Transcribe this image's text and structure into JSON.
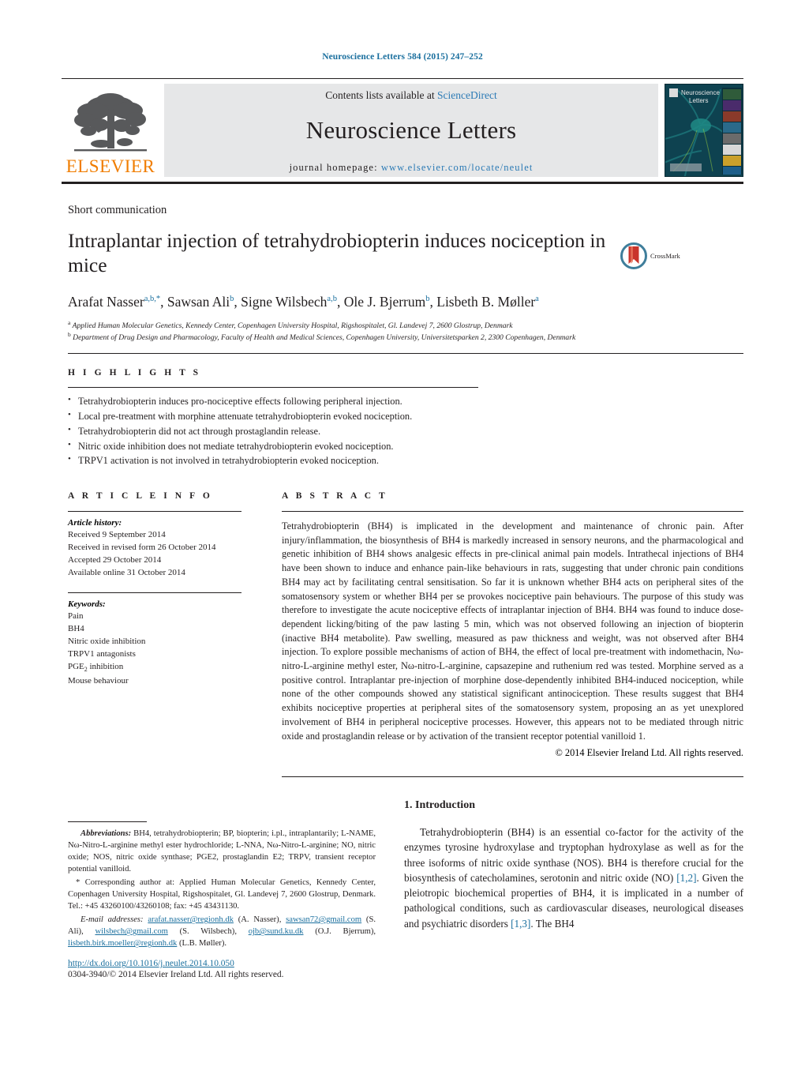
{
  "running_head": "Neuroscience Letters 584 (2015) 247–252",
  "masthead": {
    "contents_prefix": "Contents lists available at ",
    "sciencedirect": "ScienceDirect",
    "journal_name": "Neuroscience Letters",
    "homepage_prefix": "journal homepage: ",
    "homepage_url": "www.elsevier.com/locate/neulet",
    "publisher": "ELSEVIER",
    "cover_title_line1": "Neuroscience",
    "cover_title_line2": "Letters",
    "logo_icon": "elsevier-tree-icon",
    "cover_icon": "journal-cover-thumbnail"
  },
  "article": {
    "section_type": "Short communication",
    "title": "Intraplantar injection of tetrahydrobiopterin induces nociception in mice",
    "crossmark_label": "CrossMark",
    "crossmark_icon": "crossmark-icon",
    "authors": [
      {
        "name": "Arafat Nasser",
        "sup": "a,b,*"
      },
      {
        "name": "Sawsan Ali",
        "sup": "b"
      },
      {
        "name": "Signe Wilsbech",
        "sup": "a,b"
      },
      {
        "name": "Ole J. Bjerrum",
        "sup": "b"
      },
      {
        "name": "Lisbeth B. Møller",
        "sup": "a"
      }
    ],
    "affiliations": [
      {
        "marker": "a",
        "text": "Applied Human Molecular Genetics, Kennedy Center, Copenhagen University Hospital, Rigshospitalet, Gl. Landevej 7, 2600 Glostrup, Denmark"
      },
      {
        "marker": "b",
        "text": "Department of Drug Design and Pharmacology, Faculty of Health and Medical Sciences, Copenhagen University, Universitetsparken 2, 2300 Copenhagen, Denmark"
      }
    ]
  },
  "highlights": {
    "label": "H I G H L I G H T S",
    "items": [
      "Tetrahydrobiopterin induces pro-nociceptive effects following peripheral injection.",
      "Local pre-treatment with morphine attenuate tetrahydrobiopterin evoked nociception.",
      "Tetrahydrobiopterin did not act through prostaglandin release.",
      "Nitric oxide inhibition does not mediate tetrahydrobiopterin evoked nociception.",
      "TRPV1 activation is not involved in tetrahydrobiopterin evoked nociception."
    ]
  },
  "article_info": {
    "label": "A R T I C L E   I N F O",
    "history_label": "Article history:",
    "history": [
      "Received 9 September 2014",
      "Received in revised form 26 October 2014",
      "Accepted 29 October 2014",
      "Available online 31 October 2014"
    ],
    "keywords_label": "Keywords:",
    "keywords": [
      "Pain",
      "BH4",
      "Nitric oxide inhibition",
      "TRPV1 antagonists",
      "PGE2 inhibition",
      "Mouse behaviour"
    ]
  },
  "abstract": {
    "label": "A B S T R A C T",
    "text": "Tetrahydrobiopterin (BH4) is implicated in the development and maintenance of chronic pain. After injury/inflammation, the biosynthesis of BH4 is markedly increased in sensory neurons, and the pharmacological and genetic inhibition of BH4 shows analgesic effects in pre-clinical animal pain models. Intrathecal injections of BH4 have been shown to induce and enhance pain-like behaviours in rats, suggesting that under chronic pain conditions BH4 may act by facilitating central sensitisation. So far it is unknown whether BH4 acts on peripheral sites of the somatosensory system or whether BH4 per se provokes nociceptive pain behaviours. The purpose of this study was therefore to investigate the acute nociceptive effects of intraplantar injection of BH4. BH4 was found to induce dose-dependent licking/biting of the paw lasting 5 min, which was not observed following an injection of biopterin (inactive BH4 metabolite). Paw swelling, measured as paw thickness and weight, was not observed after BH4 injection. To explore possible mechanisms of action of BH4, the effect of local pre-treatment with indomethacin, Nω-nitro-L-arginine methyl ester, Nω-nitro-L-arginine, capsazepine and ruthenium red was tested. Morphine served as a positive control. Intraplantar pre-injection of morphine dose-dependently inhibited BH4-induced nociception, while none of the other compounds showed any statistical significant antinociception. These results suggest that BH4 exhibits nociceptive properties at peripheral sites of the somatosensory system, proposing an as yet unexplored involvement of BH4 in peripheral nociceptive processes. However, this appears not to be mediated through nitric oxide and prostaglandin release or by activation of the transient receptor potential vanilloid 1.",
    "copyright": "© 2014 Elsevier Ireland Ltd. All rights reserved."
  },
  "footnotes": {
    "abbreviations_label": "Abbreviations:",
    "abbreviations_text": "BH4, tetrahydrobiopterin; BP, biopterin; i.pl., intraplantarily; L-NAME, Nω-Nitro-L-arginine methyl ester hydrochloride; L-NNA, Nω-Nitro-L-arginine; NO, nitric oxide; NOS, nitric oxide synthase; PGE2, prostaglandin E2; TRPV, transient receptor potential vanilloid.",
    "corresponding_marker": "*",
    "corresponding_text": "Corresponding author at: Applied Human Molecular Genetics, Kennedy Center, Copenhagen University Hospital, Rigshospitalet, Gl. Landevej 7, 2600 Glostrup, Denmark. Tel.: +45 43260100/43260108; fax: +45 43431130.",
    "email_label": "E-mail addresses:",
    "emails": [
      {
        "address": "arafat.nasser@regionh.dk",
        "owner": "(A. Nasser)"
      },
      {
        "address": "sawsan72@gmail.com",
        "owner": "(S. Ali)"
      },
      {
        "address": "wilsbech@gmail.com",
        "owner": "(S. Wilsbech)"
      },
      {
        "address": "ojb@sund.ku.dk",
        "owner": "(O.J. Bjerrum)"
      },
      {
        "address": "lisbeth.birk.moeller@regionh.dk",
        "owner": "(L.B. Møller)"
      }
    ],
    "doi": "http://dx.doi.org/10.1016/j.neulet.2014.10.050",
    "issn_copyright": "0304-3940/© 2014 Elsevier Ireland Ltd. All rights reserved."
  },
  "introduction": {
    "heading": "1. Introduction",
    "paragraph_part1": "Tetrahydrobiopterin (BH4) is an essential co-factor for the activity of the enzymes tyrosine hydroxylase and tryptophan hydroxylase as well as for the three isoforms of nitric oxide synthase (NOS). BH4 is therefore crucial for the biosynthesis of catecholamines, serotonin and nitric oxide (NO) ",
    "ref1": "[1,2]",
    "paragraph_part2": ". Given the pleiotropic biochemical properties of BH4, it is implicated in a number of pathological conditions, such as cardiovascular diseases, neurological diseases and psychiatric disorders ",
    "ref2": "[1,3]",
    "paragraph_part3": ". The BH4"
  },
  "colors": {
    "link": "#1a6f9e",
    "elsevier_orange": "#f07d00",
    "sciencedirect_blue": "#2b7ab5",
    "band_gray": "#e6e7e8"
  }
}
